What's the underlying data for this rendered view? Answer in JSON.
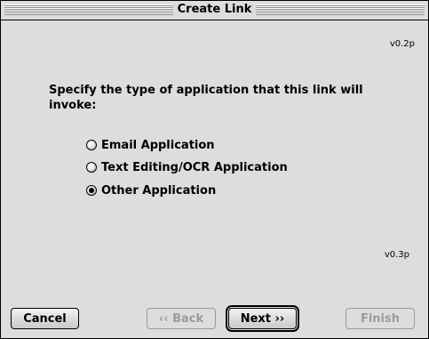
{
  "window": {
    "title": "Create Link"
  },
  "versions": {
    "top": "v0.2p",
    "bottom": "v0.3p"
  },
  "prompt": "Specify the type of application  that this link will invoke:",
  "options": [
    {
      "label": "Email Application",
      "checked": false
    },
    {
      "label": "Text Editing/OCR Application",
      "checked": false
    },
    {
      "label": "Other Application",
      "checked": true
    }
  ],
  "buttons": {
    "cancel": "Cancel",
    "back": "‹‹ Back",
    "next": "Next ››",
    "finish": "Finish"
  }
}
